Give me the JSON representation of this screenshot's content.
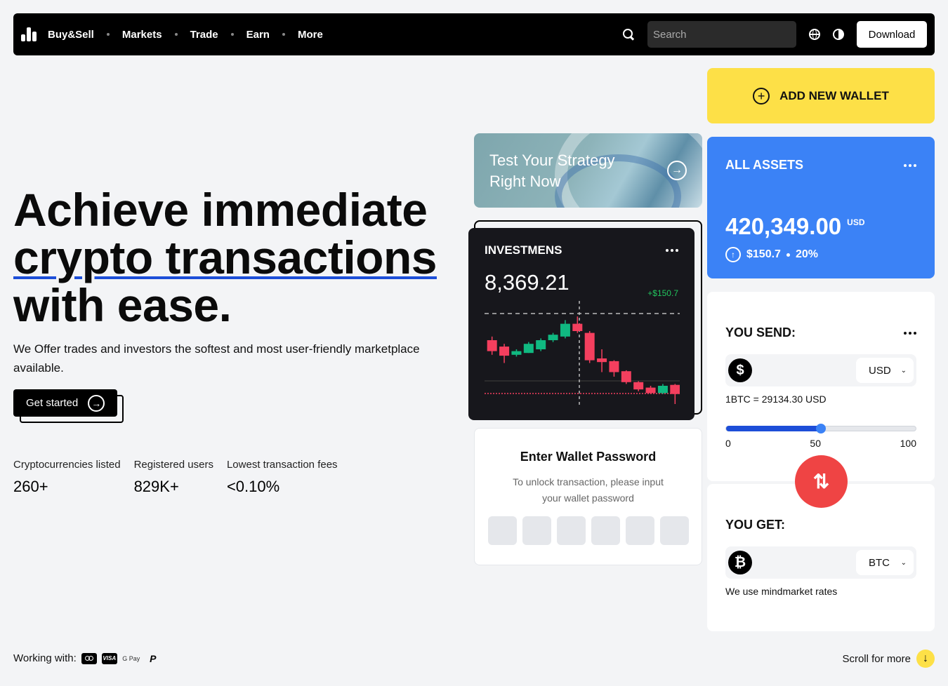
{
  "nav": {
    "brand": "Buy&Sell",
    "links": [
      "Markets",
      "Trade",
      "Earn",
      "More"
    ],
    "search_placeholder": "Search",
    "download_label": "Download"
  },
  "hero": {
    "line1": "Achieve immediate",
    "line2": "crypto transactions",
    "line3": "with ease.",
    "subtitle": "We Offer trades and investors the softest and most user-friendly marketplace available.",
    "cta": "Get started"
  },
  "stats": [
    {
      "label": "Cryptocurrencies listed",
      "value": "260+"
    },
    {
      "label": "Registered users",
      "value": "829K+"
    },
    {
      "label": "Lowest transaction fees",
      "value": "<0.10%"
    }
  ],
  "footer": {
    "working_with": "Working with:",
    "payments": [
      "mastercard-icon",
      "visa-icon",
      "gpay-icon",
      "paypal-icon"
    ],
    "gpay_text": "G Pay",
    "visa_text": "VISA",
    "paypal_text": "P",
    "scroll_more": "Scroll for more"
  },
  "strategy": {
    "line1": "Test Your Strategy",
    "line2": "Right Now"
  },
  "investments": {
    "title": "INVESTMENS",
    "amount": "8,369.21",
    "change": "+$150.7"
  },
  "password": {
    "title": "Enter Wallet Password",
    "subtitle_line1": "To unlock transaction, please input",
    "subtitle_line2": "your wallet password",
    "boxes": 6
  },
  "add_wallet": {
    "label": "ADD NEW WALLET"
  },
  "assets": {
    "title": "ALL ASSETS",
    "amount": "420,349.00",
    "currency": "USD",
    "change": "$150.7",
    "percent": "20%"
  },
  "send": {
    "title": "YOU SEND:",
    "currency": "USD",
    "rate": "1BTC = 29134.30 USD",
    "slider_value": 50,
    "slider_min": "0",
    "slider_mid": "50",
    "slider_max": "100"
  },
  "get": {
    "title": "YOU GET:",
    "currency": "BTC",
    "note": "We use mindmarket rates"
  },
  "colors": {
    "accent_blue": "#3b82f6",
    "accent_yellow": "#fde047",
    "swap_red": "#ef4444",
    "candle_up": "#10b981",
    "candle_down": "#f43f5e"
  },
  "candles": [
    {
      "o": 0.4,
      "c": 0.28,
      "h": 0.44,
      "l": 0.24,
      "dir": "down"
    },
    {
      "o": 0.33,
      "c": 0.23,
      "h": 0.36,
      "l": 0.15,
      "dir": "down"
    },
    {
      "o": 0.24,
      "c": 0.28,
      "h": 0.3,
      "l": 0.22,
      "dir": "up"
    },
    {
      "o": 0.26,
      "c": 0.36,
      "h": 0.38,
      "l": 0.26,
      "dir": "up"
    },
    {
      "o": 0.3,
      "c": 0.4,
      "h": 0.42,
      "l": 0.28,
      "dir": "up"
    },
    {
      "o": 0.4,
      "c": 0.46,
      "h": 0.48,
      "l": 0.38,
      "dir": "up"
    },
    {
      "o": 0.44,
      "c": 0.58,
      "h": 0.62,
      "l": 0.42,
      "dir": "up"
    },
    {
      "o": 0.58,
      "c": 0.5,
      "h": 0.66,
      "l": 0.48,
      "dir": "down"
    },
    {
      "o": 0.48,
      "c": 0.18,
      "h": 0.5,
      "l": 0.15,
      "dir": "down"
    },
    {
      "o": 0.2,
      "c": 0.16,
      "h": 0.3,
      "l": 0.05,
      "dir": "down"
    },
    {
      "o": 0.17,
      "c": 0.05,
      "h": 0.18,
      "l": 0.0,
      "dir": "down"
    },
    {
      "o": 0.06,
      "c": -0.06,
      "h": 0.07,
      "l": -0.08,
      "dir": "down"
    },
    {
      "o": -0.06,
      "c": -0.14,
      "h": -0.05,
      "l": -0.16,
      "dir": "down"
    },
    {
      "o": -0.12,
      "c": -0.18,
      "h": -0.1,
      "l": -0.19,
      "dir": "down"
    },
    {
      "o": -0.18,
      "c": -0.1,
      "h": -0.08,
      "l": -0.19,
      "dir": "up"
    },
    {
      "o": -0.09,
      "c": -0.19,
      "h": -0.08,
      "l": -0.3,
      "dir": "down"
    }
  ]
}
